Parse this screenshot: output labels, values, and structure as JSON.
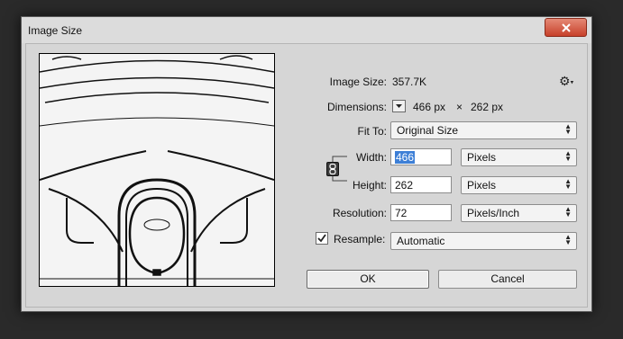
{
  "dialog": {
    "title": "Image Size"
  },
  "info": {
    "image_size_label": "Image Size:",
    "image_size_value": "357.7K",
    "dimensions_label": "Dimensions:",
    "dimensions_width": "466 px",
    "dimensions_sep": "×",
    "dimensions_height": "262 px"
  },
  "fit_to": {
    "label": "Fit To:",
    "value": "Original Size"
  },
  "width": {
    "label": "Width:",
    "value": "466",
    "unit": "Pixels"
  },
  "height": {
    "label": "Height:",
    "value": "262",
    "unit": "Pixels"
  },
  "resolution": {
    "label": "Resolution:",
    "value": "72",
    "unit": "Pixels/Inch"
  },
  "resample": {
    "label": "Resample:",
    "checked": true,
    "value": "Automatic"
  },
  "buttons": {
    "ok": "OK",
    "cancel": "Cancel"
  }
}
